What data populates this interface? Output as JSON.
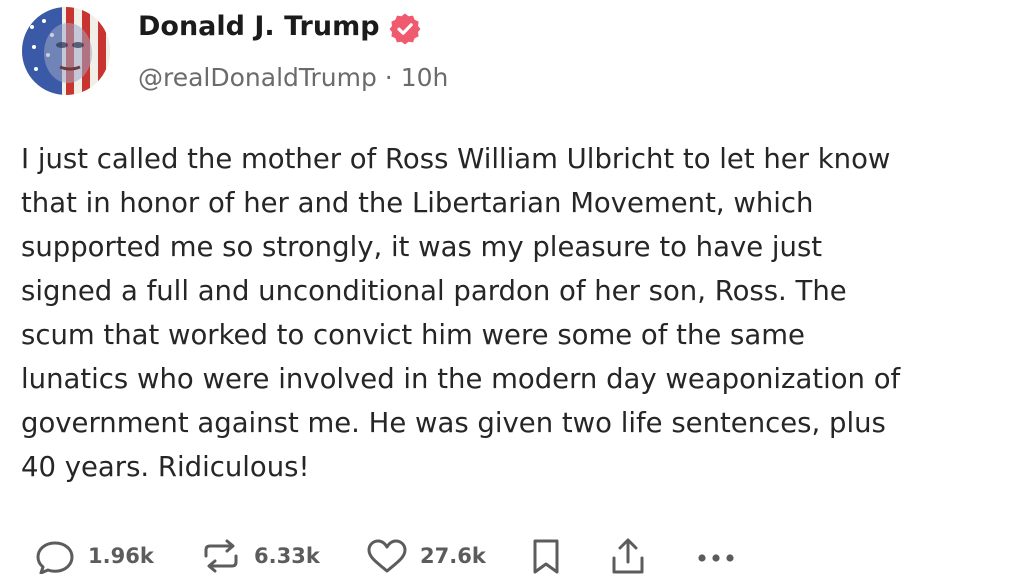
{
  "post": {
    "author_name": "Donald J. Trump",
    "handle": "@realDonaldTrump",
    "separator": "·",
    "time_ago": "10h",
    "text_lines": [
      "I just called the mother of Ross William Ulbricht to let her know",
      "that in honor of her and the Libertarian Movement, which",
      "supported me so strongly, it was my pleasure to have just",
      "signed a full and unconditional pardon of her son, Ross. The",
      "scum that worked to convict him were some of the same",
      "lunatics who were involved in the modern day weaponization of",
      "government against me. He was given two life sentences, plus",
      "40 years. Ridiculous!"
    ]
  },
  "actions": {
    "replies": "1.96k",
    "reposts": "6.33k",
    "likes": "27.6k"
  },
  "icons": {
    "verified": "verified-badge-icon",
    "reply": "comment-bubble-icon",
    "repost": "repost-icon",
    "like": "heart-icon",
    "bookmark": "bookmark-icon",
    "share": "share-icon",
    "more": "more-dots-icon"
  },
  "colors": {
    "verified_badge": "#f05a6e",
    "text": "#262626",
    "muted": "#6b6b6b"
  }
}
